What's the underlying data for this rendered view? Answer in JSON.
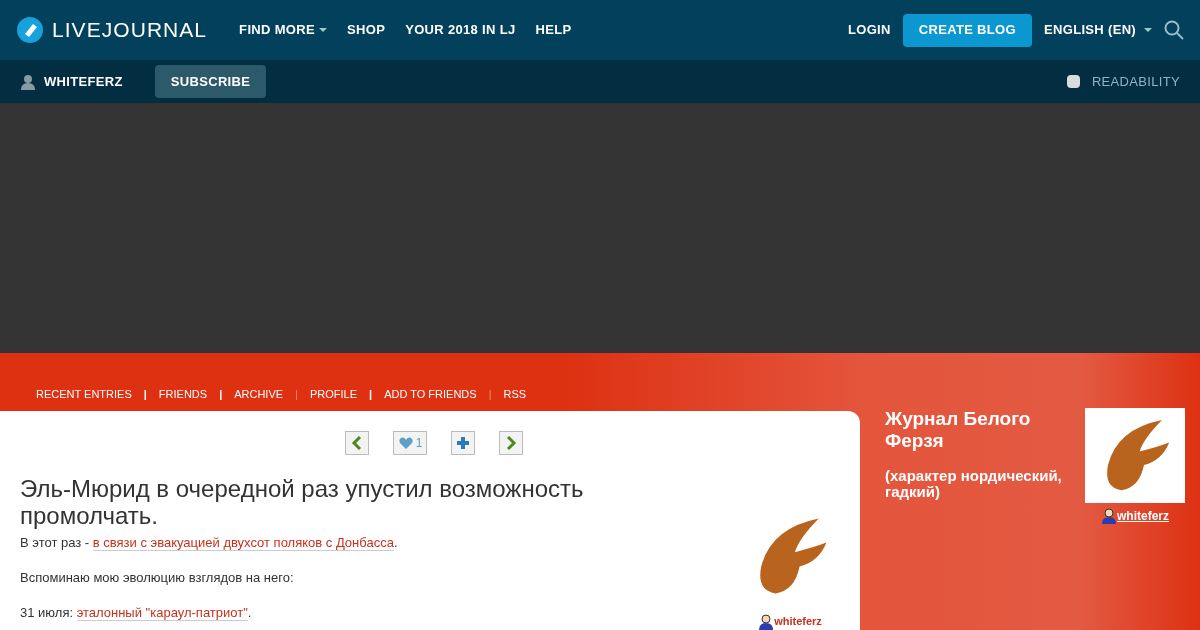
{
  "top_nav": {
    "logo": "LIVEJOURNAL",
    "items": [
      {
        "label": "FIND MORE",
        "dropdown": true
      },
      {
        "label": "SHOP",
        "dropdown": false
      },
      {
        "label": "YOUR 2018 IN LJ",
        "dropdown": false
      },
      {
        "label": "HELP",
        "dropdown": false
      }
    ],
    "login": "LOGIN",
    "create": "CREATE BLOG",
    "language": "ENGLISH (EN)"
  },
  "journal_bar": {
    "user": "WHITEFERZ",
    "subscribe": "SUBSCRIBE",
    "readability": {
      "label": "READABILITY",
      "checked": false
    }
  },
  "journal_nav": [
    {
      "kind": "link",
      "text": "RECENT ENTRIES"
    },
    {
      "kind": "separator",
      "text": "|",
      "strong": true
    },
    {
      "kind": "link",
      "text": "FRIENDS"
    },
    {
      "kind": "separator",
      "text": "|",
      "strong": true
    },
    {
      "kind": "link",
      "text": "ARCHIVE"
    },
    {
      "kind": "separator",
      "text": "|",
      "strong": false
    },
    {
      "kind": "link",
      "text": "PROFILE"
    },
    {
      "kind": "separator",
      "text": "|",
      "strong": true
    },
    {
      "kind": "link",
      "text": "ADD TO FRIENDS"
    },
    {
      "kind": "separator",
      "text": "|",
      "strong": false
    },
    {
      "kind": "link",
      "text": "RSS"
    }
  ],
  "entry": {
    "like_count": "1",
    "title": "Эль-Мюрид в очередной раз упустил возможность промолчать.",
    "paragraphs": [
      [
        {
          "kind": "text",
          "text": "В этот раз - "
        },
        {
          "kind": "link",
          "text": "в связи с эвакуацией двухсот поляков с Донбасса"
        },
        {
          "kind": "text",
          "text": "."
        }
      ],
      [
        {
          "kind": "text",
          "text": "Вспоминаю мою эволюцию взглядов на него:"
        }
      ],
      [
        {
          "kind": "text",
          "text": "31 июля: "
        },
        {
          "kind": "link",
          "text": "эталонный \"караул-патриот\""
        },
        {
          "kind": "text",
          "text": "."
        }
      ]
    ],
    "author": "whiteferz"
  },
  "sidebar": {
    "title": "Журнал Белого Ферзя",
    "subtitle": "(характер нордический, гадкий)",
    "user": "whiteferz"
  }
}
